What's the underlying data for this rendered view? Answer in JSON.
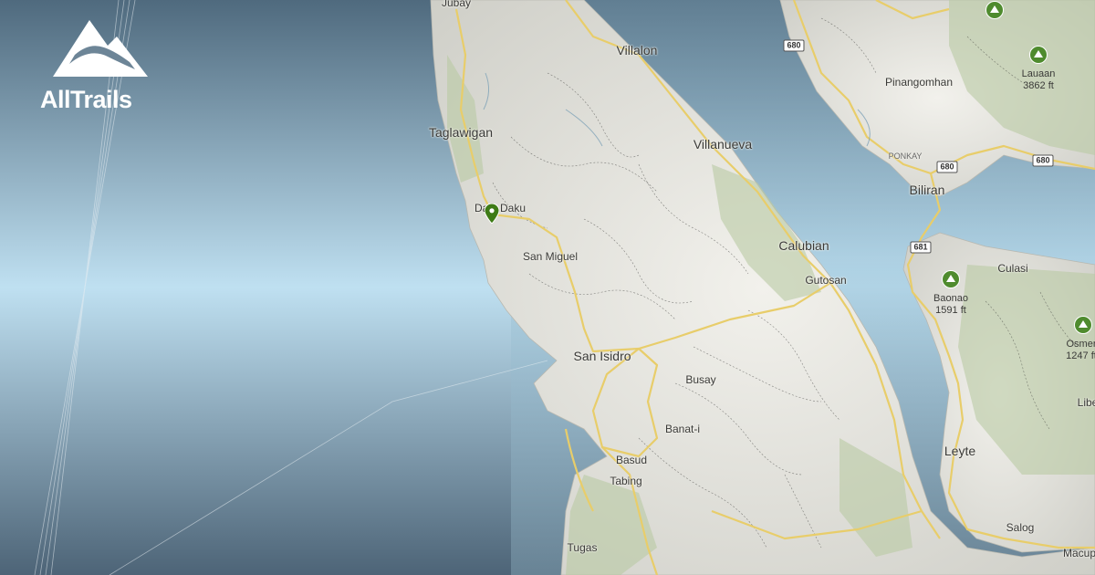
{
  "brand": {
    "name": "AllTrails",
    "logo_icon": "mountain-icon",
    "color": "#ffffff"
  },
  "map": {
    "places": [
      {
        "id": "jubay",
        "name": "Jubay",
        "size": "minor"
      },
      {
        "id": "villalon",
        "name": "Villalon",
        "size": "major"
      },
      {
        "id": "pinangomhan",
        "name": "Pinangomhan",
        "size": "minor"
      },
      {
        "id": "taglawigan",
        "name": "Taglawigan",
        "size": "major"
      },
      {
        "id": "villanueva",
        "name": "Villanueva",
        "size": "major"
      },
      {
        "id": "ponkay",
        "name": "PONKAY",
        "size": "minor"
      },
      {
        "id": "biliran",
        "name": "Biliran",
        "size": "major"
      },
      {
        "id": "dalaDaku",
        "name": "Dala Daku",
        "size": "minor"
      },
      {
        "id": "sanMiguel",
        "name": "San Miguel",
        "size": "minor"
      },
      {
        "id": "calubian",
        "name": "Calubian",
        "size": "major"
      },
      {
        "id": "culasi",
        "name": "Culasi",
        "size": "minor"
      },
      {
        "id": "gutosan",
        "name": "Gutosan",
        "size": "minor"
      },
      {
        "id": "sanIsidro",
        "name": "San Isidro",
        "size": "major"
      },
      {
        "id": "busay",
        "name": "Busay",
        "size": "minor"
      },
      {
        "id": "banati",
        "name": "Banat-i",
        "size": "minor"
      },
      {
        "id": "basud",
        "name": "Basud",
        "size": "minor"
      },
      {
        "id": "tabing",
        "name": "Tabing",
        "size": "minor"
      },
      {
        "id": "leyte",
        "name": "Leyte",
        "size": "major"
      },
      {
        "id": "libe",
        "name": "Libe",
        "size": "minor"
      },
      {
        "id": "salog",
        "name": "Salog",
        "size": "minor"
      },
      {
        "id": "tugas",
        "name": "Tugas",
        "size": "minor"
      },
      {
        "id": "macup",
        "name": "Macup",
        "size": "minor"
      }
    ],
    "peaks": [
      {
        "id": "lauaan",
        "name": "Lauaan",
        "elevation": "3862 ft"
      },
      {
        "id": "baonao",
        "name": "Baonao",
        "elevation": "1591 ft"
      },
      {
        "id": "osmer",
        "name": "Osmer",
        "elevation": "1247 ft"
      }
    ],
    "road_shields": [
      "680",
      "680",
      "680",
      "681"
    ],
    "trail_marker": {
      "icon": "map-pin-icon",
      "color": "#3e7b16"
    },
    "colors": {
      "water": "#7fa3b8",
      "land": "#e6e5df",
      "road": "#e8cd6a",
      "forest": "#b9c9a3"
    }
  }
}
